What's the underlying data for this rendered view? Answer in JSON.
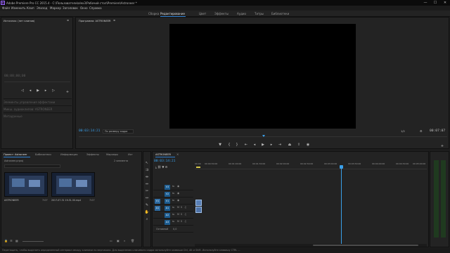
{
  "titlebar": {
    "app_icon": "Pr",
    "title": "Adobe Premiere Pro CC 2015.4 - C:\\Пользователи\\alex3\\Рабочий стол\\Premiere\\Astroneer *",
    "minimize": "—",
    "maximize": "☐",
    "close": "✕"
  },
  "menu": [
    "Файл",
    "Изменить",
    "Клип",
    "Эпизод",
    "Маркер",
    "Заголовок",
    "Окно",
    "Справка"
  ],
  "workspaces": [
    "Сборка",
    "Редактирование",
    "Цвет",
    "Эффекты",
    "Аудио",
    "Титры",
    "Библиотеки"
  ],
  "source_panel": {
    "title": "Источник: (нет клипов)",
    "menu_icon": "≡",
    "timecode": "00;00;00;00",
    "labels": [
      "Элементы управления эффектами",
      "Микш. аудиоклипов: ASTRONEER",
      "Метаданные"
    ]
  },
  "program_panel": {
    "title": "Программа: ASTRONEER",
    "menu_icon": "≡",
    "timecode": "00:03:14:21",
    "fit_label": "По размеру кадра",
    "quality": "1/2",
    "duration": "00:07:07"
  },
  "project_panel": {
    "tabs": [
      "Проект: Astroneer",
      "Библиотеки",
      "Информация",
      "Эффекты",
      "Маркеры",
      "Ист"
    ],
    "subtitle": "Astroneer.prproj",
    "count": "2 элемента",
    "items": [
      {
        "name": "ASTRONEER",
        "duration": "7:07"
      },
      {
        "name": "2017-07-31 19-51-50.mp4",
        "duration": "7:07"
      }
    ]
  },
  "timeline": {
    "tab": "ASTRONEER",
    "timecode": "00:03:14:21",
    "ruler_ticks": [
      "00:00",
      "00:00:30:00",
      "00:01:00:00",
      "00:01:30:00",
      "00:02:00:00",
      "00:02:30:00",
      "00:03:00:00",
      "00:03:30:00",
      "00:04:00:00",
      "00:04:30:00",
      "00:05:00:00",
      "00:05:30:00"
    ],
    "video_tracks": [
      "V3",
      "V2",
      "V1"
    ],
    "audio_tracks": [
      "A1",
      "A2",
      "A3"
    ],
    "master_label": "Основной",
    "master_value": "0,0"
  },
  "status": {
    "text": "Перетащить, чтобы выделить определенный интервал между клипами по вертикали. Для выделения ключевого кадра используйте клавиши Ctrl, Alt и Shift. Используйте клавишу CTRL ..."
  },
  "colors": {
    "accent": "#2f7fcf",
    "timecode": "#3a9fe8",
    "clip": "#5a80b7"
  }
}
